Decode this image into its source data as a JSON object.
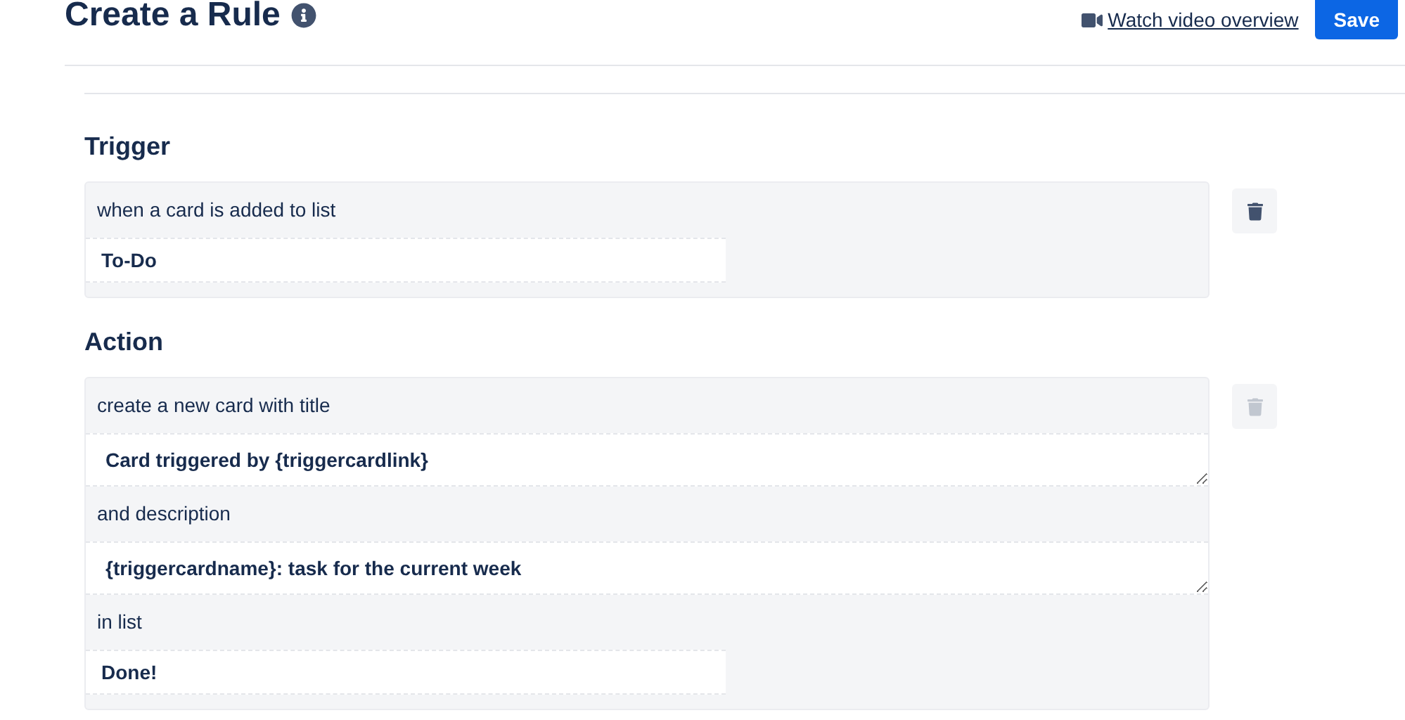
{
  "header": {
    "title": "Create a Rule",
    "video_link": "Watch video overview",
    "save_button": "Save"
  },
  "sections": [
    {
      "heading": "Trigger",
      "delete_disabled": false,
      "rows": [
        {
          "kind": "text",
          "text": "when a card is added to list"
        },
        {
          "kind": "field",
          "value": "To-Do"
        }
      ]
    },
    {
      "heading": "Action",
      "delete_disabled": true,
      "rows": [
        {
          "kind": "text",
          "text": "create a new card with title"
        },
        {
          "kind": "textarea",
          "value": "Card triggered by {triggercardlink}"
        },
        {
          "kind": "text",
          "text": "and description"
        },
        {
          "kind": "textarea",
          "value": "{triggercardname}: task for the current week"
        },
        {
          "kind": "text",
          "text": "in list"
        },
        {
          "kind": "field",
          "value": "Done!"
        }
      ]
    }
  ]
}
